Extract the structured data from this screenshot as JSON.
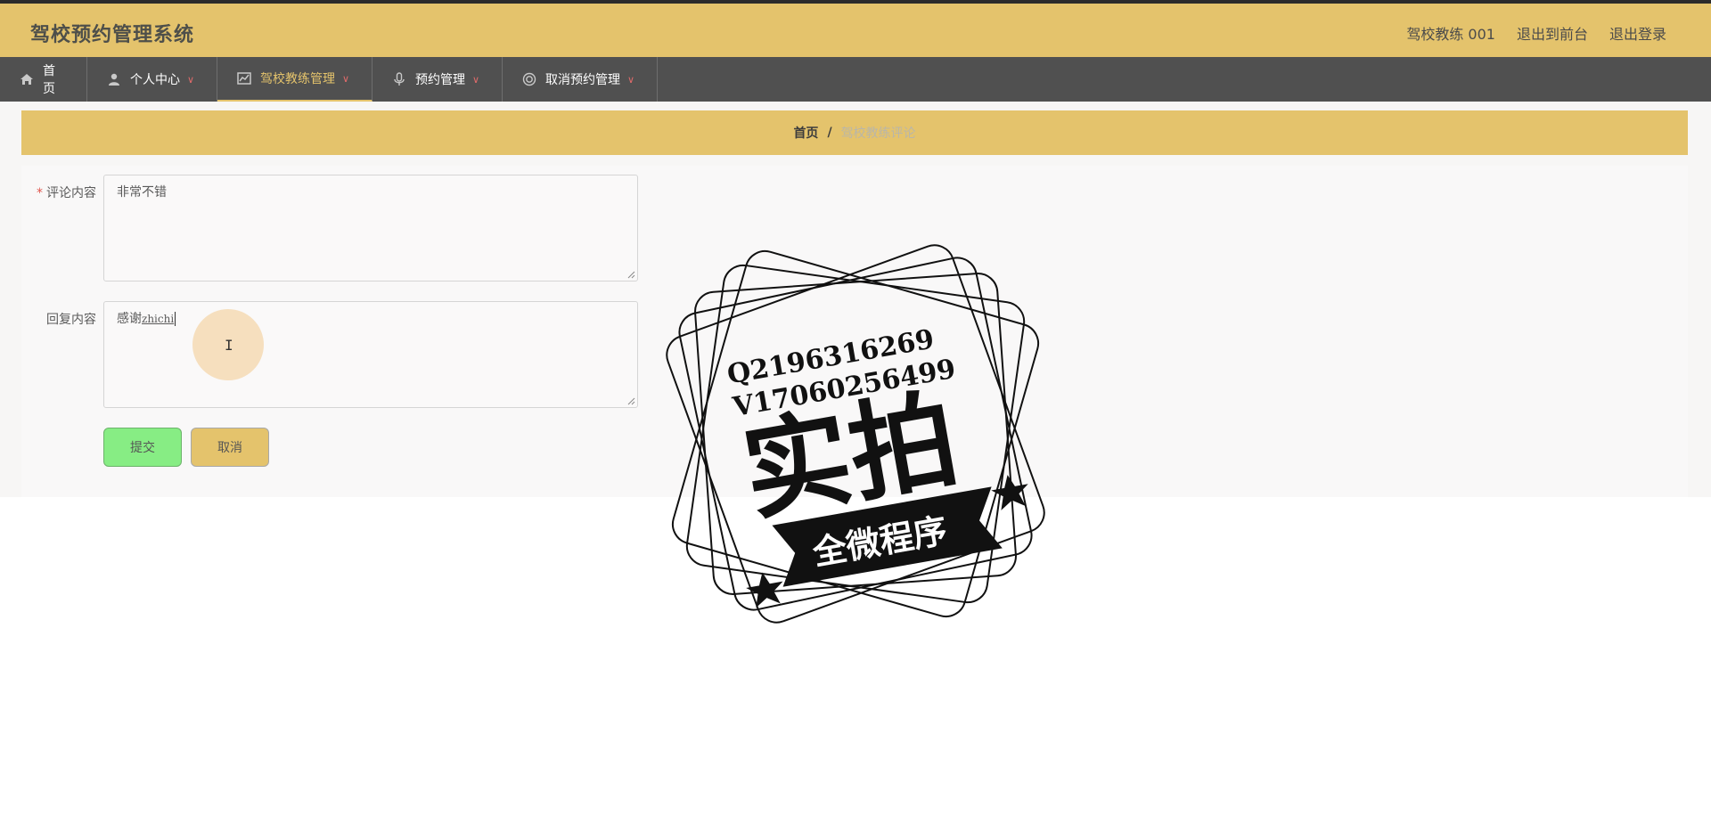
{
  "header": {
    "title": "驾校预约管理系统",
    "user": "驾校教练 001",
    "back_to_front": "退出到前台",
    "logout": "退出登录"
  },
  "nav": {
    "items": [
      {
        "label": "首页",
        "icon": "home-icon"
      },
      {
        "label": "个人中心",
        "icon": "user-icon"
      },
      {
        "label": "驾校教练管理",
        "icon": "chart-icon"
      },
      {
        "label": "预约管理",
        "icon": "mic-icon"
      },
      {
        "label": "取消预约管理",
        "icon": "circle-icon"
      }
    ]
  },
  "breadcrumb": {
    "home": "首页",
    "separator": "/",
    "current": "驾校教练评论"
  },
  "form": {
    "comment_label": "评论内容",
    "comment_value": "非常不错",
    "reply_label": "回复内容",
    "reply_value": "感谢",
    "reply_ime": "zhichi",
    "submit_label": "提交",
    "cancel_label": "取消"
  },
  "watermark": {
    "line1": "Q2196316269",
    "line2": "V17060256499",
    "big": "实拍",
    "ribbon": "全微程序"
  },
  "colors": {
    "accent": "#e4c36c",
    "nav_bg": "#505050",
    "submit_bg": "#87ed84"
  }
}
